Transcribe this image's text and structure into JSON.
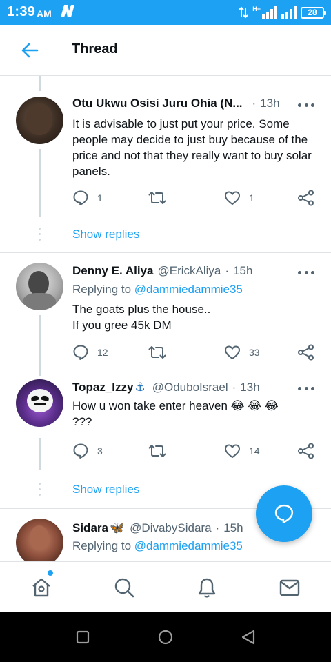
{
  "status_bar": {
    "time": "1:39",
    "ampm": "AM",
    "network_label": "H+",
    "battery": "28"
  },
  "header": {
    "title": "Thread",
    "back_icon": "arrow-left-icon"
  },
  "tweets": [
    {
      "name": "Otu Ukwu Osisi Juru Ohia (N...",
      "handle": "",
      "time": "13h",
      "replying_to": null,
      "text": "It is advisable to just put your price. Some people may decide to just buy because of the price and not that they really want to buy solar panels.",
      "replies": "1",
      "retweets": "",
      "likes": "1"
    },
    {
      "name": "Denny E. Aliya",
      "handle": "@ErickAliya",
      "time": "15h",
      "replying_to_prefix": "Replying to",
      "replying_to": "@dammiedammie35",
      "text_line1": "The goats plus the house..",
      "text_line2": "If you gree 45k DM",
      "replies": "12",
      "retweets": "",
      "likes": "33"
    },
    {
      "name": "Topaz_Izzy",
      "name_emoji": "⚓",
      "handle": "@OduboIsrael",
      "time": "13h",
      "text_line1": "How u won take enter heaven 😂 😂 😂",
      "text_line2": "???",
      "replies": "3",
      "retweets": "",
      "likes": "14"
    },
    {
      "name": "Sidara",
      "name_emoji": "🦋",
      "handle": "@DivabySidara",
      "time": "15h",
      "replying_to_prefix": "Replying to",
      "replying_to": "@dammiedammie35"
    }
  ],
  "show_replies_label": "Show replies",
  "colors": {
    "accent": "#1da1f2",
    "text": "#0f1419",
    "muted": "#536471",
    "border": "#dfe3e6"
  },
  "fab_icon": "reply-bubble-icon",
  "bottom_nav": [
    "home-icon",
    "search-icon",
    "bell-icon",
    "mail-icon"
  ]
}
